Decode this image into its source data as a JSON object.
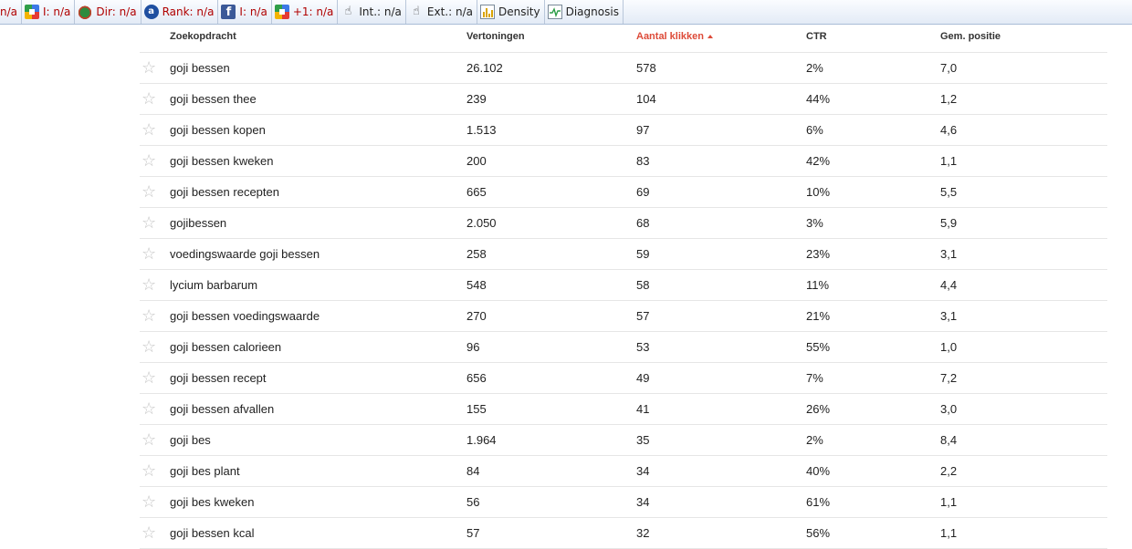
{
  "toolbar": {
    "items": [
      {
        "label": "n/a",
        "icon": "",
        "color": "red"
      },
      {
        "label": "I: n/a",
        "icon": "google-icon",
        "color": "red"
      },
      {
        "label": "Dir: n/a",
        "icon": "dmoz-icon",
        "color": "red"
      },
      {
        "label": "Rank: n/a",
        "icon": "rank-icon",
        "color": "red"
      },
      {
        "label": "I: n/a",
        "icon": "facebook-icon",
        "color": "red"
      },
      {
        "label": "+1: n/a",
        "icon": "google-plus-icon",
        "color": "red"
      },
      {
        "label": "Int.: n/a",
        "icon": "internal-links-icon",
        "color": "dark"
      },
      {
        "label": "Ext.: n/a",
        "icon": "external-links-icon",
        "color": "dark"
      },
      {
        "label": "Density",
        "icon": "density-icon",
        "color": "dark"
      },
      {
        "label": "Diagnosis",
        "icon": "diagnosis-icon",
        "color": "dark"
      }
    ]
  },
  "table": {
    "headers": {
      "query": "Zoekopdracht",
      "impressions": "Vertoningen",
      "clicks": "Aantal klikken",
      "ctr": "CTR",
      "position": "Gem. positie"
    },
    "sorted_column": "clicks",
    "sort_direction": "descending",
    "rows": [
      {
        "query": "goji bessen",
        "impressions": "26.102",
        "clicks": "578",
        "ctr": "2%",
        "position": "7,0"
      },
      {
        "query": "goji bessen thee",
        "impressions": "239",
        "clicks": "104",
        "ctr": "44%",
        "position": "1,2"
      },
      {
        "query": "goji bessen kopen",
        "impressions": "1.513",
        "clicks": "97",
        "ctr": "6%",
        "position": "4,6"
      },
      {
        "query": "goji bessen kweken",
        "impressions": "200",
        "clicks": "83",
        "ctr": "42%",
        "position": "1,1"
      },
      {
        "query": "goji bessen recepten",
        "impressions": "665",
        "clicks": "69",
        "ctr": "10%",
        "position": "5,5"
      },
      {
        "query": "gojibessen",
        "impressions": "2.050",
        "clicks": "68",
        "ctr": "3%",
        "position": "5,9"
      },
      {
        "query": "voedingswaarde goji bessen",
        "impressions": "258",
        "clicks": "59",
        "ctr": "23%",
        "position": "3,1"
      },
      {
        "query": "lycium barbarum",
        "impressions": "548",
        "clicks": "58",
        "ctr": "11%",
        "position": "4,4"
      },
      {
        "query": "goji bessen voedingswaarde",
        "impressions": "270",
        "clicks": "57",
        "ctr": "21%",
        "position": "3,1"
      },
      {
        "query": "goji bessen calorieen",
        "impressions": "96",
        "clicks": "53",
        "ctr": "55%",
        "position": "1,0"
      },
      {
        "query": "goji bessen recept",
        "impressions": "656",
        "clicks": "49",
        "ctr": "7%",
        "position": "7,2"
      },
      {
        "query": "goji bessen afvallen",
        "impressions": "155",
        "clicks": "41",
        "ctr": "26%",
        "position": "3,0"
      },
      {
        "query": "goji bes",
        "impressions": "1.964",
        "clicks": "35",
        "ctr": "2%",
        "position": "8,4"
      },
      {
        "query": "goji bes plant",
        "impressions": "84",
        "clicks": "34",
        "ctr": "40%",
        "position": "2,2"
      },
      {
        "query": "goji bes kweken",
        "impressions": "56",
        "clicks": "34",
        "ctr": "61%",
        "position": "1,1"
      },
      {
        "query": "goji bessen kcal",
        "impressions": "57",
        "clicks": "32",
        "ctr": "56%",
        "position": "1,1"
      }
    ]
  },
  "colors": {
    "sorted_header": "#dd4b39",
    "toolbar_value": "#b00000",
    "star": "#c6c6c6"
  }
}
